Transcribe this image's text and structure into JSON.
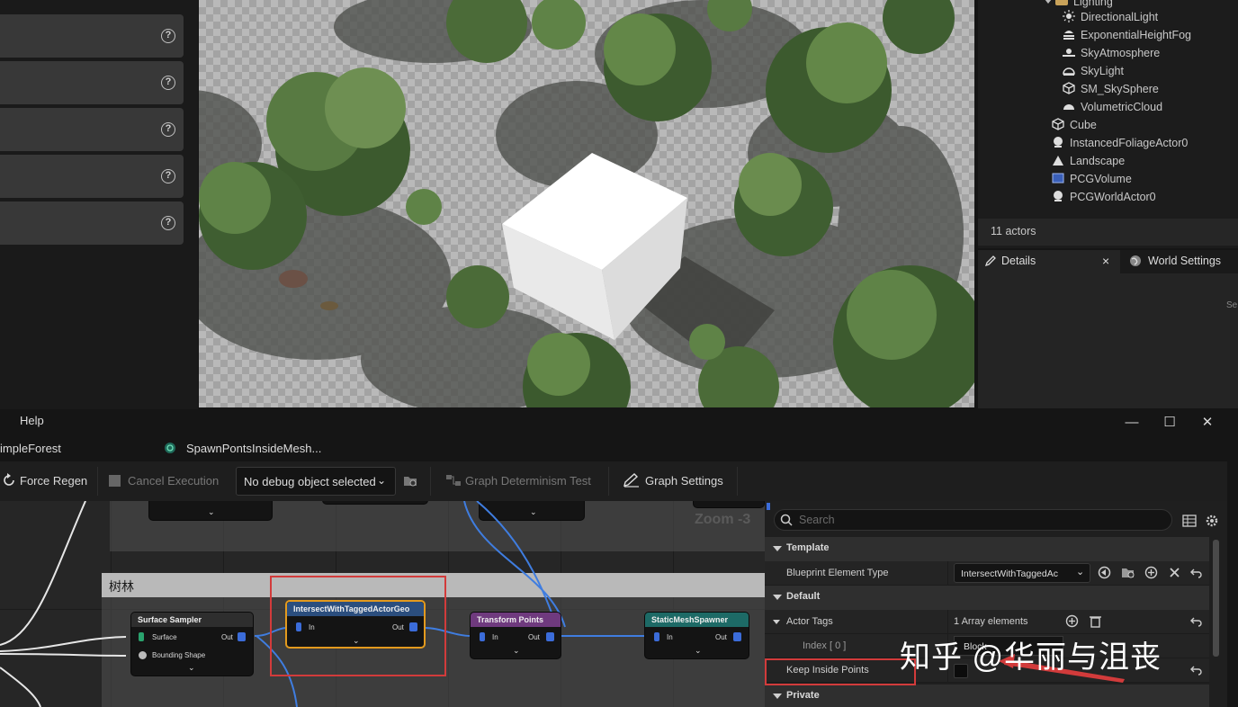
{
  "left_panel": {
    "help_glyph": "?",
    "rows": 5
  },
  "outliner": {
    "items": [
      {
        "label": "Lighting",
        "icon": "folder-icon",
        "level": 0
      },
      {
        "label": "DirectionalLight",
        "icon": "sun-light-icon",
        "level": 1
      },
      {
        "label": "ExponentialHeightFog",
        "icon": "fog-icon",
        "level": 1
      },
      {
        "label": "SkyAtmosphere",
        "icon": "sky-atmosphere-icon",
        "level": 1
      },
      {
        "label": "SkyLight",
        "icon": "skylight-icon",
        "level": 1
      },
      {
        "label": "SM_SkySphere",
        "icon": "static-mesh-icon",
        "level": 1
      },
      {
        "label": "VolumetricCloud",
        "icon": "cloud-icon",
        "level": 1
      },
      {
        "label": "Cube",
        "icon": "static-mesh-icon",
        "level": 0
      },
      {
        "label": "InstancedFoliageActor0",
        "icon": "actor-icon",
        "level": 0
      },
      {
        "label": "Landscape",
        "icon": "landscape-icon",
        "level": 0
      },
      {
        "label": "PCGVolume",
        "icon": "volume-icon",
        "level": 0
      },
      {
        "label": "PCGWorldActor0",
        "icon": "actor-icon",
        "level": 0
      }
    ],
    "actor_count": "11 actors"
  },
  "details_tabs": {
    "details": "Details",
    "world_settings": "World Settings",
    "close": "×",
    "search_stub": "Se"
  },
  "pcg_window": {
    "menu_help": "Help",
    "tabs": {
      "left": "impleForest",
      "graph": "SpawnPontsInsideMesh..."
    },
    "window_buttons": {
      "minimize": "—",
      "maximize": "☐",
      "close": "✕"
    }
  },
  "toolbar": {
    "force_regen": "Force Regen",
    "cancel_execution": "Cancel Execution",
    "debug_select": "No debug object selected",
    "graph_determinism": "Graph Determinism Test",
    "graph_settings": "Graph Settings"
  },
  "graph": {
    "zoom": "Zoom -3",
    "comment_title": "树林",
    "nodes": {
      "surface_sampler": {
        "title": "Surface Sampler",
        "pin_surface": "Surface",
        "pin_bounding": "Bounding Shape",
        "pin_out": "Out"
      },
      "intersect": {
        "title": "IntersectWithTaggedActorGeo",
        "pin_in": "In",
        "pin_out": "Out"
      },
      "transform": {
        "title": "Transform Points",
        "pin_in": "In",
        "pin_out": "Out"
      },
      "spawner": {
        "title": "StaticMeshSpawner",
        "pin_in": "In",
        "pin_out": "Out"
      }
    }
  },
  "details_panel": {
    "search_placeholder": "Search",
    "sections": {
      "template": "Template",
      "default": "Default",
      "private": "Private"
    },
    "rows": {
      "blueprint_element_type": {
        "name": "Blueprint Element Type",
        "value": "IntersectWithTaggedAc"
      },
      "actor_tags": {
        "name": "Actor Tags",
        "value": "1 Array elements"
      },
      "index0": {
        "name": "Index [ 0 ]",
        "value": "Block"
      },
      "keep_inside": {
        "name": "Keep Inside Points"
      }
    }
  },
  "watermark": "知乎 @华丽与沮丧",
  "colors": {
    "highlight_red": "#d23b3b",
    "wire_blue": "#3f7de0",
    "surface_title": "#2e2e2e",
    "intersect_title": "#2b4e7e",
    "transform_title": "#6f3a7e",
    "spawner_title": "#1d6a66"
  }
}
